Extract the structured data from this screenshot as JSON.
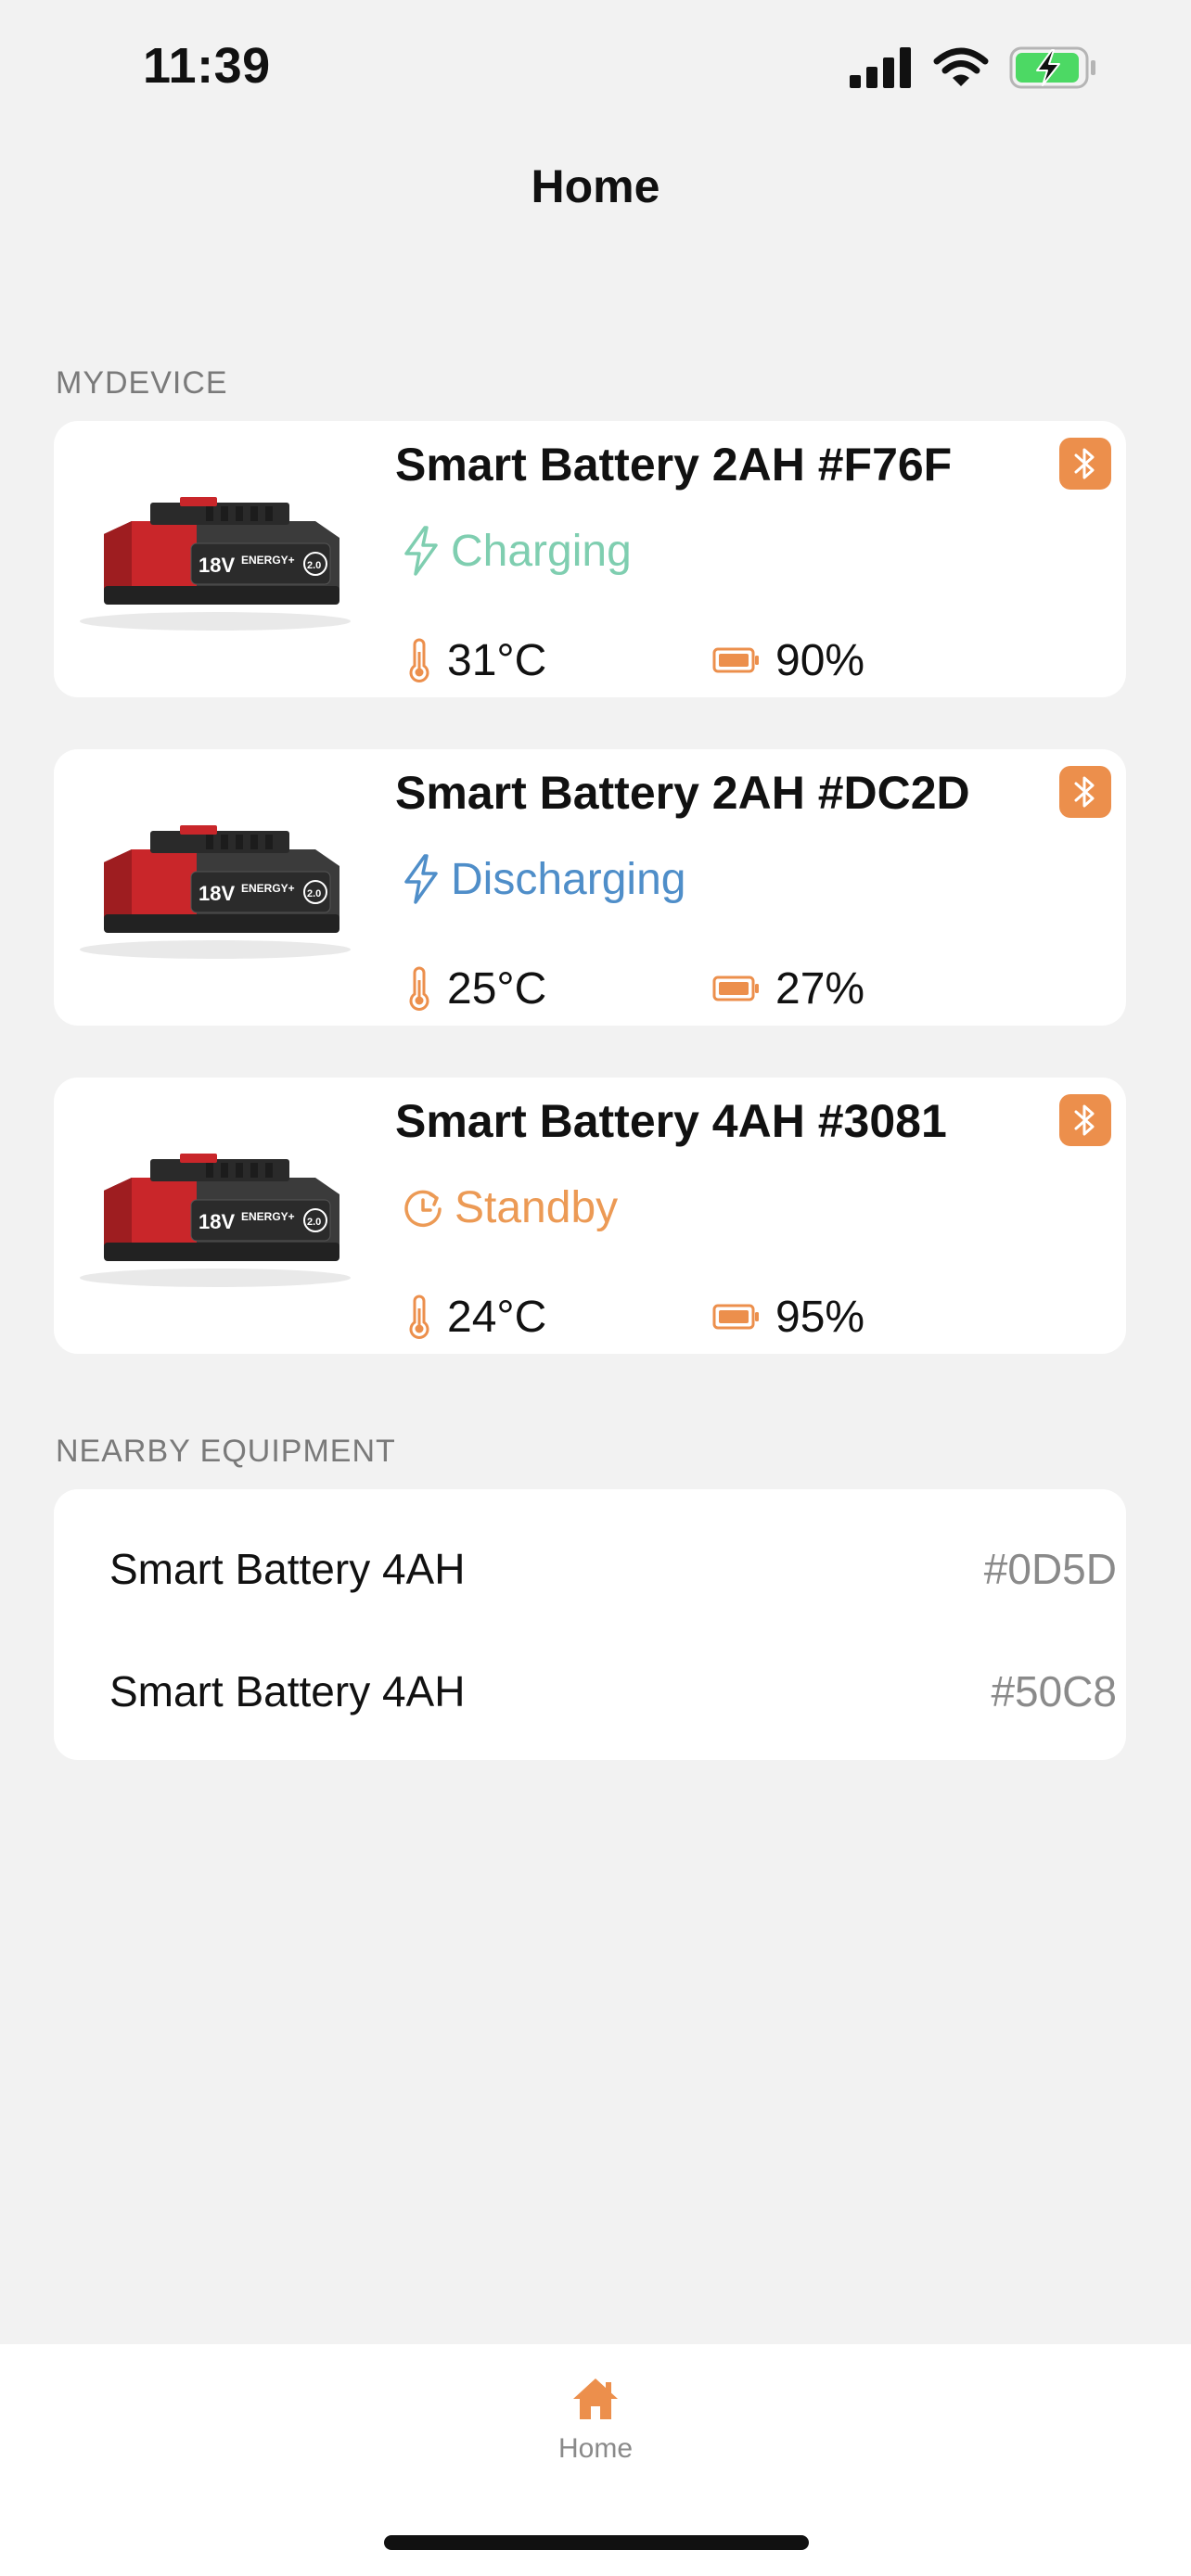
{
  "status_bar": {
    "time": "11:39"
  },
  "nav": {
    "title": "Home"
  },
  "sections": {
    "my_device": "MYDEVICE",
    "nearby": "NEARBY EQUIPMENT"
  },
  "colors": {
    "accent": "#ec8f4c",
    "charging": "#7fceb0",
    "discharging": "#4f8ec9",
    "standby": "#ec9a55"
  },
  "devices": [
    {
      "name": "Smart Battery 2AH #F76F",
      "status": "Charging",
      "status_icon": "lightning-icon",
      "temperature": "31°C",
      "battery": "90%"
    },
    {
      "name": "Smart Battery 2AH #DC2D",
      "status": "Discharging",
      "status_icon": "lightning-icon",
      "temperature": "25°C",
      "battery": "27%"
    },
    {
      "name": "Smart Battery 4AH #3081",
      "status": "Standby",
      "status_icon": "clock-icon",
      "temperature": "24°C",
      "battery": "95%"
    }
  ],
  "battery_label": {
    "voltage": "18V",
    "brand": "ENERGY+",
    "capacity": "2.0"
  },
  "nearby": [
    {
      "name": "Smart Battery 4AH",
      "id": "#0D5D"
    },
    {
      "name": "Smart Battery 4AH",
      "id": "#50C8"
    }
  ],
  "tab_bar": {
    "home_label": "Home"
  }
}
